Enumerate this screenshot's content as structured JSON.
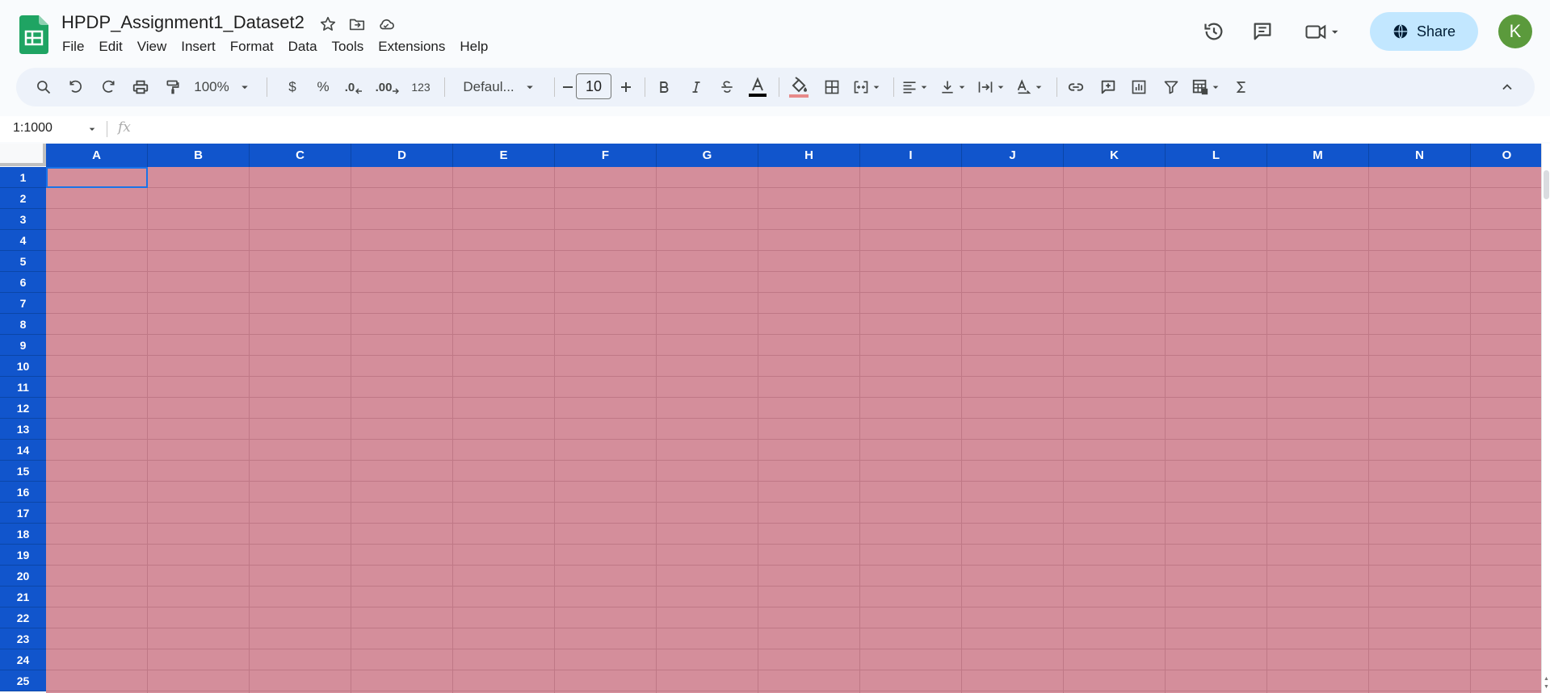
{
  "title": "HPDP_Assignment1_Dataset2",
  "menu": [
    "File",
    "Edit",
    "View",
    "Insert",
    "Format",
    "Data",
    "Tools",
    "Extensions",
    "Help"
  ],
  "header": {
    "share_label": "Share",
    "avatar_letter": "K"
  },
  "toolbar": {
    "zoom": "100%",
    "currency": "$",
    "percent": "%",
    "decrease_decimal": ".0",
    "increase_decimal": ".00",
    "number_format": "123",
    "font": "Defaul...",
    "font_size": "10"
  },
  "formula_bar": {
    "name_box": "1:1000",
    "fx": "fx"
  },
  "columns": [
    "A",
    "B",
    "C",
    "D",
    "E",
    "F",
    "G",
    "H",
    "I",
    "J",
    "K",
    "L",
    "M",
    "N",
    "O"
  ],
  "rows": [
    "1",
    "2",
    "3",
    "4",
    "5",
    "6",
    "7",
    "8",
    "9",
    "10",
    "11",
    "12",
    "13",
    "14",
    "15",
    "16",
    "17",
    "18",
    "19",
    "20",
    "21",
    "22",
    "23",
    "24",
    "25"
  ],
  "colors": {
    "header_fill": "#1155cc",
    "cell_fill": "#d48e9b",
    "share_bg": "#c2e7ff",
    "avatar_bg": "#5b9a3c"
  }
}
